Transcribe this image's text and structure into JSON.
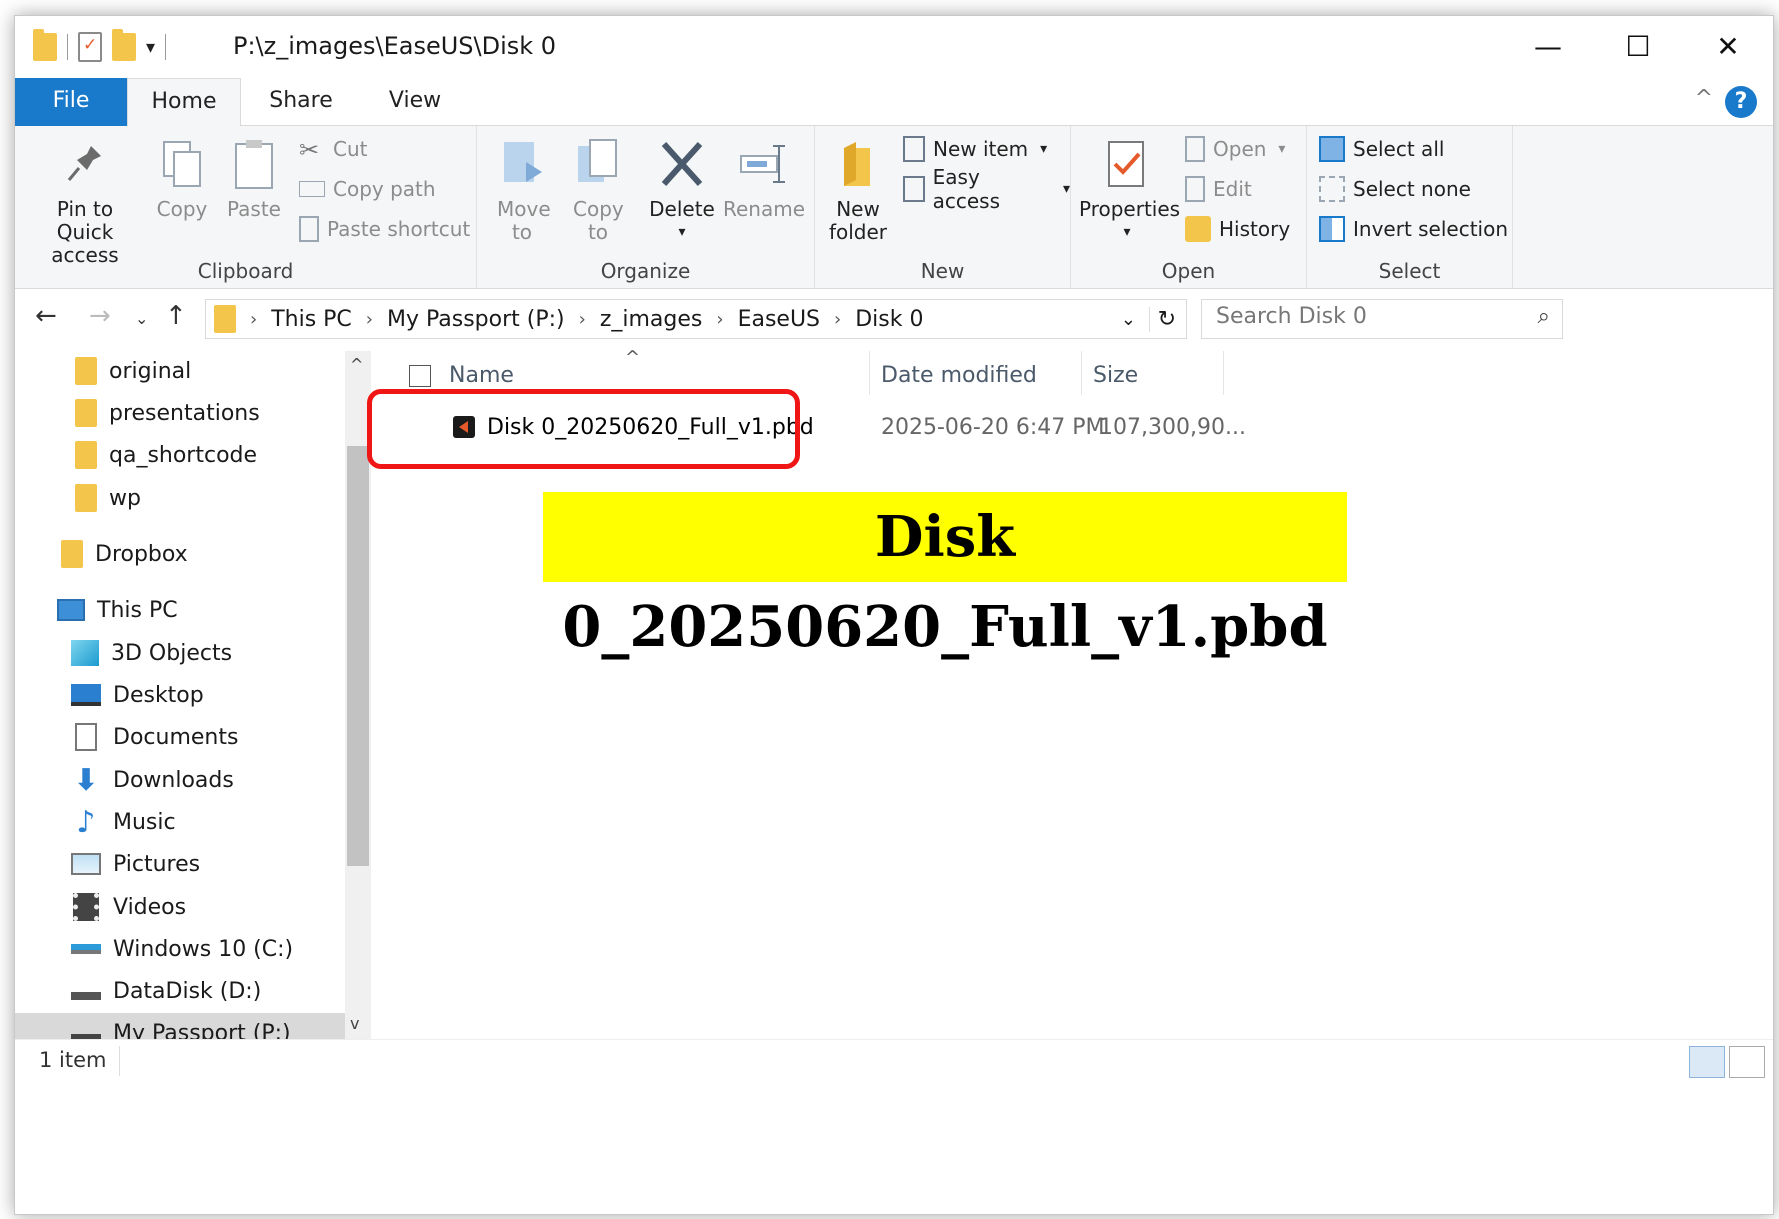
{
  "window": {
    "title_path": "P:\\z_images\\EaseUS\\Disk 0",
    "controls": {
      "minimize": "—",
      "maximize": "☐",
      "close": "✕"
    }
  },
  "tabs": [
    {
      "label": "File"
    },
    {
      "label": "Home"
    },
    {
      "label": "Share"
    },
    {
      "label": "View"
    }
  ],
  "help_label": "?",
  "ribbon": {
    "clipboard": {
      "label": "Clipboard",
      "pin": "Pin to Quick access",
      "copy": "Copy",
      "paste": "Paste",
      "cut": "Cut",
      "copy_path": "Copy path",
      "paste_shortcut": "Paste shortcut"
    },
    "organize": {
      "label": "Organize",
      "move_to": "Move to",
      "copy_to": "Copy to",
      "delete": "Delete",
      "rename": "Rename"
    },
    "new": {
      "label": "New",
      "new_folder": "New folder",
      "new_item": "New item",
      "easy_access": "Easy access"
    },
    "open": {
      "label": "Open",
      "properties": "Properties",
      "open": "Open",
      "edit": "Edit",
      "history": "History"
    },
    "select": {
      "label": "Select",
      "select_all": "Select all",
      "select_none": "Select none",
      "invert": "Invert selection"
    }
  },
  "address": {
    "crumbs": [
      "This PC",
      "My Passport (P:)",
      "z_images",
      "EaseUS",
      "Disk 0"
    ],
    "search_placeholder": "Search Disk 0"
  },
  "nav_items": [
    {
      "label": "original",
      "icon": "folder-icon"
    },
    {
      "label": "presentations",
      "icon": "folder-icon"
    },
    {
      "label": "qa_shortcode",
      "icon": "folder-icon"
    },
    {
      "label": "wp",
      "icon": "folder-icon"
    },
    {
      "label": "Dropbox",
      "icon": "folder-icon"
    },
    {
      "label": "This PC",
      "icon": "computer-icon"
    },
    {
      "label": "3D Objects",
      "icon": "cube-icon"
    },
    {
      "label": "Desktop",
      "icon": "desktop-icon"
    },
    {
      "label": "Documents",
      "icon": "document-icon"
    },
    {
      "label": "Downloads",
      "icon": "download-icon"
    },
    {
      "label": "Music",
      "icon": "music-note-icon"
    },
    {
      "label": "Pictures",
      "icon": "picture-icon"
    },
    {
      "label": "Videos",
      "icon": "film-icon"
    },
    {
      "label": "Windows 10 (C:)",
      "icon": "drive-icon"
    },
    {
      "label": "DataDisk (D:)",
      "icon": "drive-icon"
    },
    {
      "label": "My Passport (P:)",
      "icon": "drive-icon"
    }
  ],
  "columns": {
    "name": "Name",
    "date": "Date modified",
    "size": "Size"
  },
  "files": [
    {
      "name": "Disk 0_20250620_Full_v1.pbd",
      "date": "2025-06-20 6:47 PM",
      "size": "107,300,90..."
    }
  ],
  "banner_text": "Disk 0_20250620_Full_v1.pbd",
  "status": {
    "count": "1 item"
  },
  "colors": {
    "accent": "#1979ca",
    "highlight_border": "#f01616",
    "banner_bg": "#ffff00",
    "folder": "#f3c54a"
  }
}
